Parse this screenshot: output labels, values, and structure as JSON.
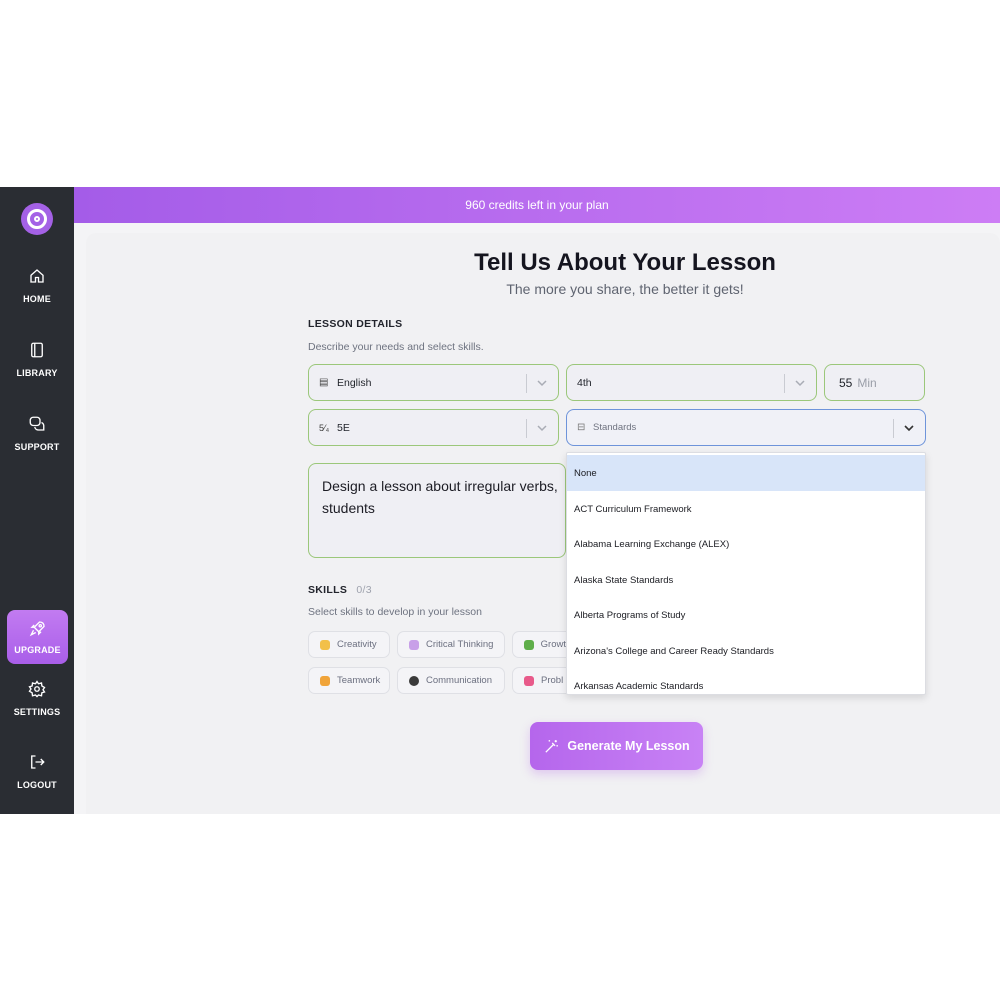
{
  "banner": {
    "credits_text": "960 credits left in your plan"
  },
  "sidebar": {
    "items": [
      {
        "label": "HOME",
        "icon": "home-icon"
      },
      {
        "label": "LIBRARY",
        "icon": "book-icon"
      },
      {
        "label": "SUPPORT",
        "icon": "chat-bubble-icon"
      },
      {
        "label": "UPGRADE",
        "icon": "rocket-icon"
      },
      {
        "label": "SETTINGS",
        "icon": "gear-icon"
      },
      {
        "label": "LOGOUT",
        "icon": "logout-icon"
      }
    ]
  },
  "main": {
    "title": "Tell Us About Your Lesson",
    "subtitle": "The more you share, the better it gets!"
  },
  "lesson_details": {
    "heading": "LESSON DETAILS",
    "hint": "Describe your needs and select skills.",
    "subject": "English",
    "grade": "4th",
    "duration_value": "55",
    "duration_unit": "Min",
    "framework": "5E",
    "standards_placeholder": "Standards",
    "prompt": "Design a lesson about irregular verbs, students"
  },
  "skills": {
    "heading": "SKILLS",
    "count": "0/3",
    "hint": "Select skills to develop in your lesson",
    "items": [
      {
        "label": "Creativity",
        "color": "#f2c04a"
      },
      {
        "label": "Critical Thinking",
        "color": "#c8a0e8"
      },
      {
        "label": "Growt",
        "color": "#5fae4a"
      },
      {
        "label": "Teamwork",
        "color": "#f0a43a"
      },
      {
        "label": "Communication",
        "color": "#3a3a3a"
      },
      {
        "label": "Probl",
        "color": "#e85a8a"
      }
    ]
  },
  "standards_dropdown": {
    "options": [
      "None",
      "ACT Curriculum Framework",
      "Alabama Learning Exchange (ALEX)",
      "Alaska State Standards",
      "Alberta Programs of Study",
      "Arizona's College and Career Ready Standards",
      "Arkansas Academic Standards"
    ],
    "highlighted": "None"
  },
  "generate_button": {
    "label": "Generate My Lesson"
  },
  "colors": {
    "accent": "#b566ec",
    "field_border": "#9bc77a",
    "sidebar": "#2a2d33"
  }
}
